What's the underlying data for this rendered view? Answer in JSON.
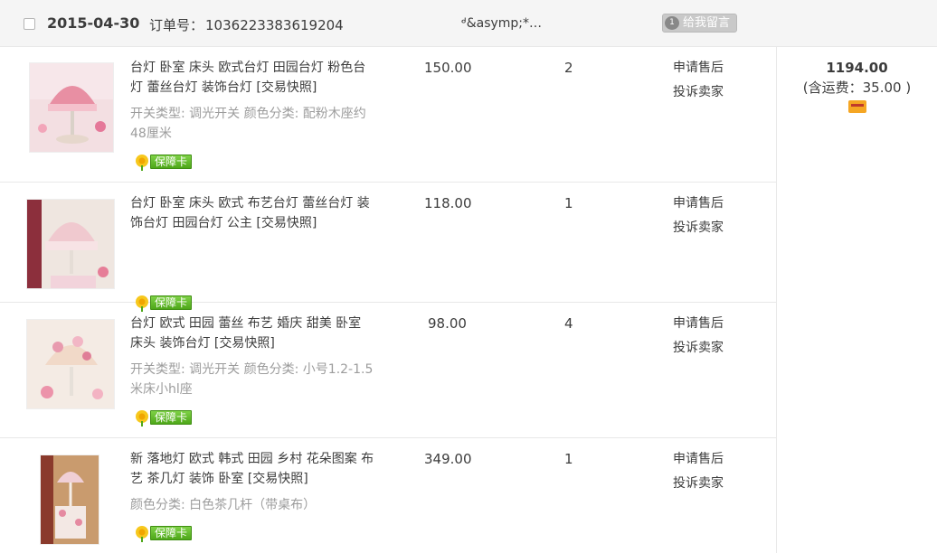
{
  "order": {
    "date": "2015-04-30",
    "order_no_label": "订单号：",
    "order_no": "1036223383619204",
    "seller": "ᒄ&asymp;*…",
    "message_button": "给我留言",
    "message_count": "1"
  },
  "items": [
    {
      "title": "台灯 卧室 床头 欧式台灯 田园台灯 粉色台灯 蕾丝台灯 装饰台灯",
      "snapshot": "[交易快照]",
      "attrs": "开关类型: 调光开关  颜色分类: 配粉木座约48厘米",
      "guarantee": "保障卡",
      "price": "150.00",
      "qty": "2",
      "action_1": "申请售后",
      "action_2": "投诉卖家"
    },
    {
      "title": "台灯 卧室 床头 欧式 布艺台灯 蕾丝台灯 装饰台灯 田园台灯 公主",
      "snapshot": "[交易快照]",
      "attrs": "",
      "guarantee": "保障卡",
      "price": "118.00",
      "qty": "1",
      "action_1": "申请售后",
      "action_2": "投诉卖家"
    },
    {
      "title": "台灯 欧式 田园 蕾丝 布艺 婚庆 甜美 卧室 床头 装饰台灯",
      "snapshot": "[交易快照]",
      "attrs": "开关类型: 调光开关  颜色分类: 小号1.2-1.5米床小hl座",
      "guarantee": "保障卡",
      "price": "98.00",
      "qty": "4",
      "action_1": "申请售后",
      "action_2": "投诉卖家"
    },
    {
      "title": "新 落地灯 欧式 韩式 田园 乡村 花朵图案 布艺 茶几灯 装饰 卧室",
      "snapshot": "[交易快照]",
      "attrs": "颜色分类: 白色茶几杆（带桌布）",
      "guarantee": "保障卡",
      "price": "349.00",
      "qty": "1",
      "action_1": "申请售后",
      "action_2": "投诉卖家"
    }
  ],
  "summary": {
    "total": "1194.00",
    "shipping": "(含运费：35.00 )"
  },
  "icons": {
    "guarantee": "sun-flower-icon",
    "payment": "payment-card-icon",
    "message": "speech-bubble-icon"
  },
  "colors": {
    "guarantee_green": "#4ea719",
    "header_bg": "#f5f5f5",
    "muted_text": "#9c9c9c"
  }
}
